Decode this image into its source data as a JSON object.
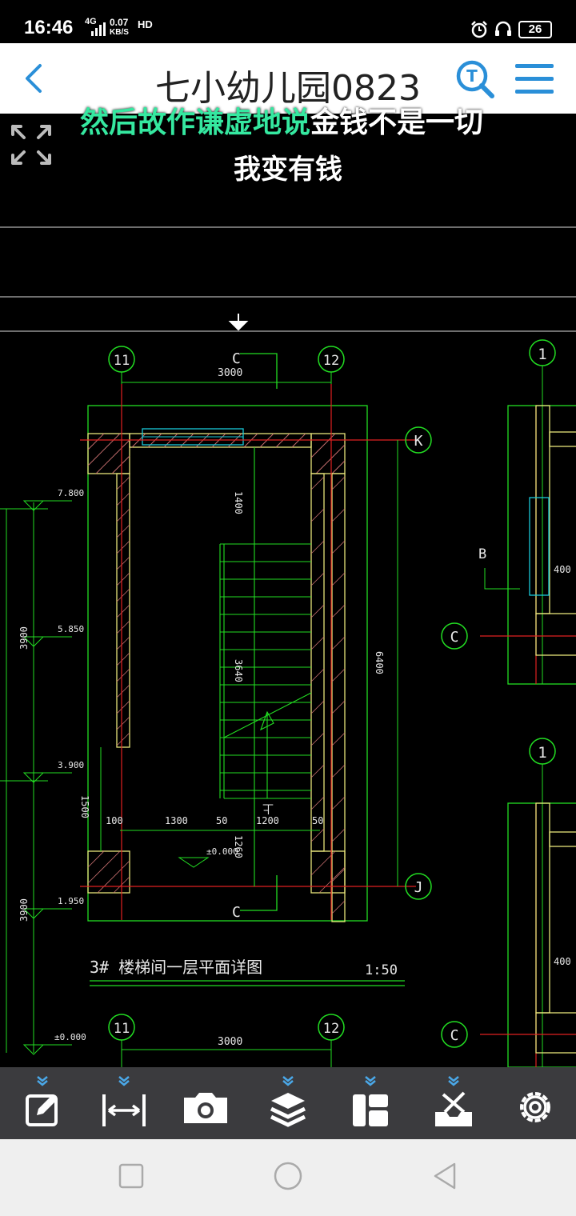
{
  "status_bar": {
    "time": "16:46",
    "network": "4G",
    "speed_value": "0.07",
    "speed_unit": "KB/S",
    "hd": "HD",
    "battery": "26"
  },
  "app_bar": {
    "title": "七小幼儿园0823"
  },
  "overlay": {
    "subtitle_line1_highlight": "然后故作谦虚地说",
    "subtitle_line1_rest": "金钱不是一切",
    "subtitle_line2": "我变有钱"
  },
  "drawing": {
    "grid_11": "11",
    "grid_12": "12",
    "grid_1": "1",
    "grid_K": "K",
    "grid_J": "J",
    "grid_C": "C",
    "section_C": "C",
    "label_B": "B",
    "dim_3000": "3000",
    "dim_3000_b": "3000",
    "dim_1400": "1400",
    "dim_3640": "3640",
    "dim_6400": "6400",
    "dim_1260": "1260",
    "dim_1500": "1500",
    "dim_100": "100",
    "dim_1300": "1300",
    "dim_50": "50",
    "dim_1200": "1200",
    "dim_50b": "50",
    "dim_3900": "3900",
    "dim_3900b": "3900",
    "dim_400": "400",
    "dim_400b": "400",
    "elev_7800": "7.800",
    "elev_5850": "5.850",
    "elev_3900": "3.900",
    "elev_1950": "1.950",
    "elev_0": "±0.000",
    "elev_0_b": "±0.000",
    "up_mark": "上",
    "detail_title": "3# 楼梯间一层平面详图",
    "scale": "1:50"
  },
  "toolbar": {
    "tools": [
      "edit-tool",
      "measure-tool",
      "screenshot-tool",
      "layers-tool",
      "layout-tool",
      "toolbox-tool",
      "settings-tool"
    ]
  },
  "colors": {
    "green": "#22dd22",
    "red": "#e02020",
    "yellow": "#e6e37a",
    "cyan": "#19c8d8",
    "accent_blue": "#2a8fd8"
  }
}
